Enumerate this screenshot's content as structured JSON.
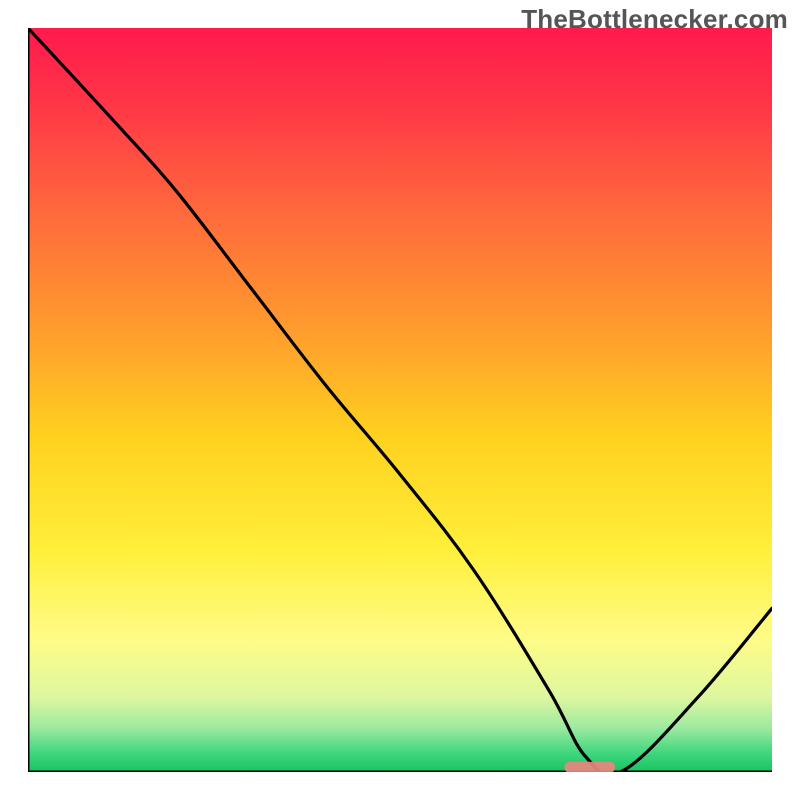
{
  "watermark": {
    "text": "TheBottlenecker.com"
  },
  "chart_data": {
    "type": "line",
    "title": "",
    "xlabel": "",
    "ylabel": "",
    "xlim": [
      0,
      100
    ],
    "ylim": [
      0,
      100
    ],
    "x": [
      0,
      12,
      20,
      30,
      40,
      50,
      60,
      70,
      75,
      80,
      90,
      100
    ],
    "values": [
      100,
      87,
      78,
      65,
      52,
      40,
      27,
      11,
      2,
      0.2,
      10,
      22
    ],
    "marker": {
      "x_center": 75.5,
      "x_half_width": 3.4,
      "y": 0.7
    },
    "gradient_stops": [
      {
        "offset": 0.0,
        "color": "#ff1a4d"
      },
      {
        "offset": 0.1,
        "color": "#ff3547"
      },
      {
        "offset": 0.25,
        "color": "#ff6a3c"
      },
      {
        "offset": 0.4,
        "color": "#ff9a2e"
      },
      {
        "offset": 0.55,
        "color": "#ffd11f"
      },
      {
        "offset": 0.7,
        "color": "#ffef3a"
      },
      {
        "offset": 0.82,
        "color": "#fffc86"
      },
      {
        "offset": 0.9,
        "color": "#ddf7a0"
      },
      {
        "offset": 0.94,
        "color": "#9eeaa0"
      },
      {
        "offset": 0.975,
        "color": "#3fd67e"
      },
      {
        "offset": 1.0,
        "color": "#17c45f"
      }
    ]
  }
}
